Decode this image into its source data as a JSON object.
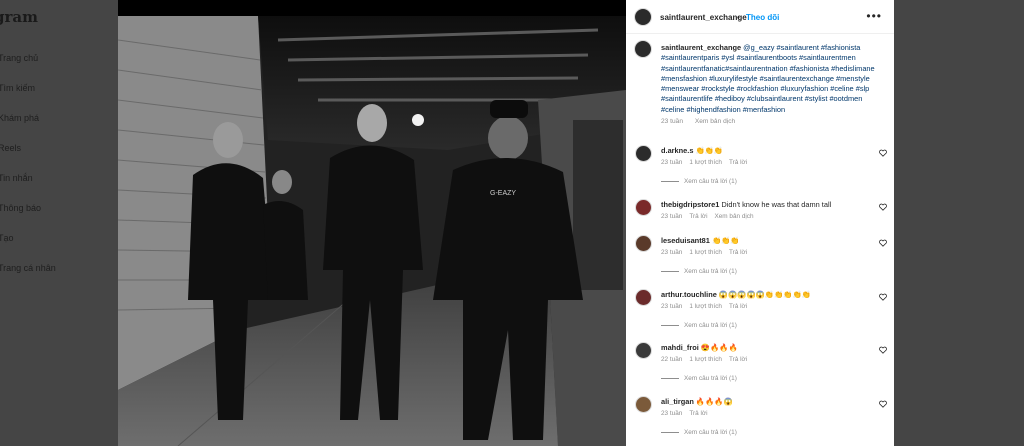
{
  "sidebar": {
    "brand": "gram",
    "items": [
      {
        "label": "Trang chủ"
      },
      {
        "label": "Tìm kiếm"
      },
      {
        "label": "Khám phá"
      },
      {
        "label": "Reels"
      },
      {
        "label": "Tin nhắn"
      },
      {
        "label": "Thông báo"
      },
      {
        "label": "Tạo"
      },
      {
        "label": "Trang cá nhân"
      }
    ]
  },
  "header": {
    "username": "saintlaurent_exchange",
    "separator": "•",
    "follow": "Theo dõi",
    "more": "•••"
  },
  "caption": {
    "username": "saintlaurent_exchange",
    "text": "@g_eazy #saintlaurent #fashionista #saintlaurentparis #ysl #saintlaurentboots #saintlaurentmen #saintlaurentfanatic#saintlaurentnation #fashionista #hedislimane #mensfashion #luxurylifestyle #saintlaurentexchange #menstyle #menswear #rockstyle #rockfashion #luxuryfashion #celine #slp #saintlaurentlife #hediboy #clubsaintlaurent #stylist #ootdmen #celine #highendfashion #menfashion",
    "time": "23 tuần",
    "translate": "Xem bản dịch"
  },
  "comments": [
    {
      "user": "d.arkne.s",
      "text": "👏👏👏",
      "time": "23 tuần",
      "likes": "1 lượt thích",
      "reply": "Trả lời",
      "view_replies": "Xem câu trả lời (1)"
    },
    {
      "user": "thebigdripstore1",
      "text": "Didn't know he was that damn tall",
      "time": "23 tuần",
      "reply": "Trả lời",
      "translate": "Xem bản dịch"
    },
    {
      "user": "leseduisant81",
      "text": "👏👏👏",
      "time": "23 tuần",
      "likes": "1 lượt thích",
      "reply": "Trả lời",
      "view_replies": "Xem câu trả lời (1)"
    },
    {
      "user": "arthur.touchline",
      "text": "😱😱😱😱😱👏👏👏👏👏",
      "time": "23 tuần",
      "likes": "1 lượt thích",
      "reply": "Trả lời",
      "view_replies": "Xem câu trả lời (1)"
    },
    {
      "user": "mahdi_froi",
      "text": "😍🔥🔥🔥",
      "time": "22 tuần",
      "likes": "1 lượt thích",
      "reply": "Trả lời",
      "view_replies": "Xem câu trả lời (1)"
    },
    {
      "user": "ali_tirgan",
      "text": "🔥🔥🔥😱",
      "time": "23 tuần",
      "reply": "Trả lời",
      "view_replies": "Xem câu trả lời (1)"
    }
  ]
}
